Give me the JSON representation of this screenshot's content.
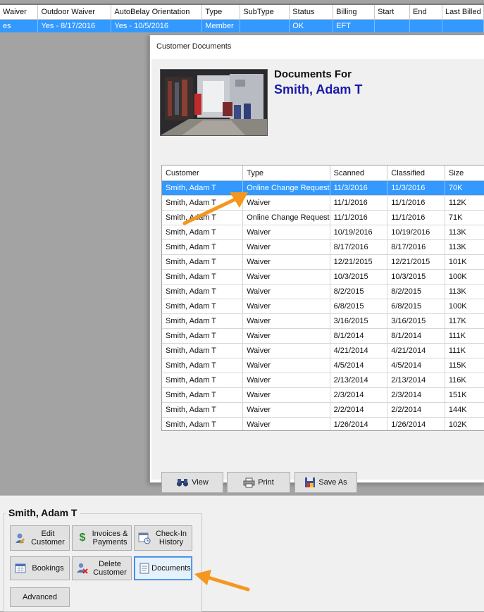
{
  "member_grid": {
    "columns": [
      "Waiver",
      "Outdoor Waiver",
      "AutoBelay Orientation",
      "Type",
      "SubType",
      "Status",
      "Billing",
      "Start",
      "End",
      "Last Billed"
    ],
    "selected_row": [
      "es",
      "Yes - 8/17/2016",
      "Yes - 10/5/2016",
      "Member",
      "",
      "OK",
      "EFT",
      "",
      "",
      ""
    ]
  },
  "dialog": {
    "title": "Customer Documents",
    "documents_for_label": "Documents For",
    "customer_name": "Smith, Adam T",
    "columns": [
      "Customer",
      "Type",
      "Scanned",
      "Classified",
      "Size"
    ],
    "rows": [
      [
        "Smith, Adam T",
        "Online Change Request",
        "11/3/2016",
        "11/3/2016",
        "70K"
      ],
      [
        "Smith, Adam T",
        "Waiver",
        "11/1/2016",
        "11/1/2016",
        "112K"
      ],
      [
        "Smith, Adam T",
        "Online Change Request",
        "11/1/2016",
        "11/1/2016",
        "71K"
      ],
      [
        "Smith, Adam T",
        "Waiver",
        "10/19/2016",
        "10/19/2016",
        "113K"
      ],
      [
        "Smith, Adam T",
        "Waiver",
        "8/17/2016",
        "8/17/2016",
        "113K"
      ],
      [
        "Smith, Adam T",
        "Waiver",
        "12/21/2015",
        "12/21/2015",
        "101K"
      ],
      [
        "Smith, Adam T",
        "Waiver",
        "10/3/2015",
        "10/3/2015",
        "100K"
      ],
      [
        "Smith, Adam T",
        "Waiver",
        "8/2/2015",
        "8/2/2015",
        "113K"
      ],
      [
        "Smith, Adam T",
        "Waiver",
        "6/8/2015",
        "6/8/2015",
        "100K"
      ],
      [
        "Smith, Adam T",
        "Waiver",
        "3/16/2015",
        "3/16/2015",
        "117K"
      ],
      [
        "Smith, Adam T",
        "Waiver",
        "8/1/2014",
        "8/1/2014",
        "111K"
      ],
      [
        "Smith, Adam T",
        "Waiver",
        "4/21/2014",
        "4/21/2014",
        "111K"
      ],
      [
        "Smith, Adam T",
        "Waiver",
        "4/5/2014",
        "4/5/2014",
        "115K"
      ],
      [
        "Smith, Adam T",
        "Waiver",
        "2/13/2014",
        "2/13/2014",
        "116K"
      ],
      [
        "Smith, Adam T",
        "Waiver",
        "2/3/2014",
        "2/3/2014",
        "151K"
      ],
      [
        "Smith, Adam T",
        "Waiver",
        "2/2/2014",
        "2/2/2014",
        "144K"
      ],
      [
        "Smith, Adam T",
        "Waiver",
        "1/26/2014",
        "1/26/2014",
        "102K"
      ]
    ],
    "buttons": {
      "view": "View",
      "print": "Print",
      "save_as": "Save As"
    }
  },
  "bottom_panel": {
    "member_name": "Smith, Adam T",
    "buttons": {
      "edit_customer": "Edit\nCustomer",
      "invoices_payments": "Invoices &\nPayments",
      "checkin_history": "Check-In\nHistory",
      "bookings": "Bookings",
      "delete_customer": "Delete\nCustomer",
      "documents": "Documents",
      "advanced": "Advanced"
    }
  },
  "colors": {
    "selection": "#3399ff",
    "customer_name": "#1a1aa8",
    "annotation_arrow": "#f5961e",
    "focus_border": "#2a7de1"
  }
}
